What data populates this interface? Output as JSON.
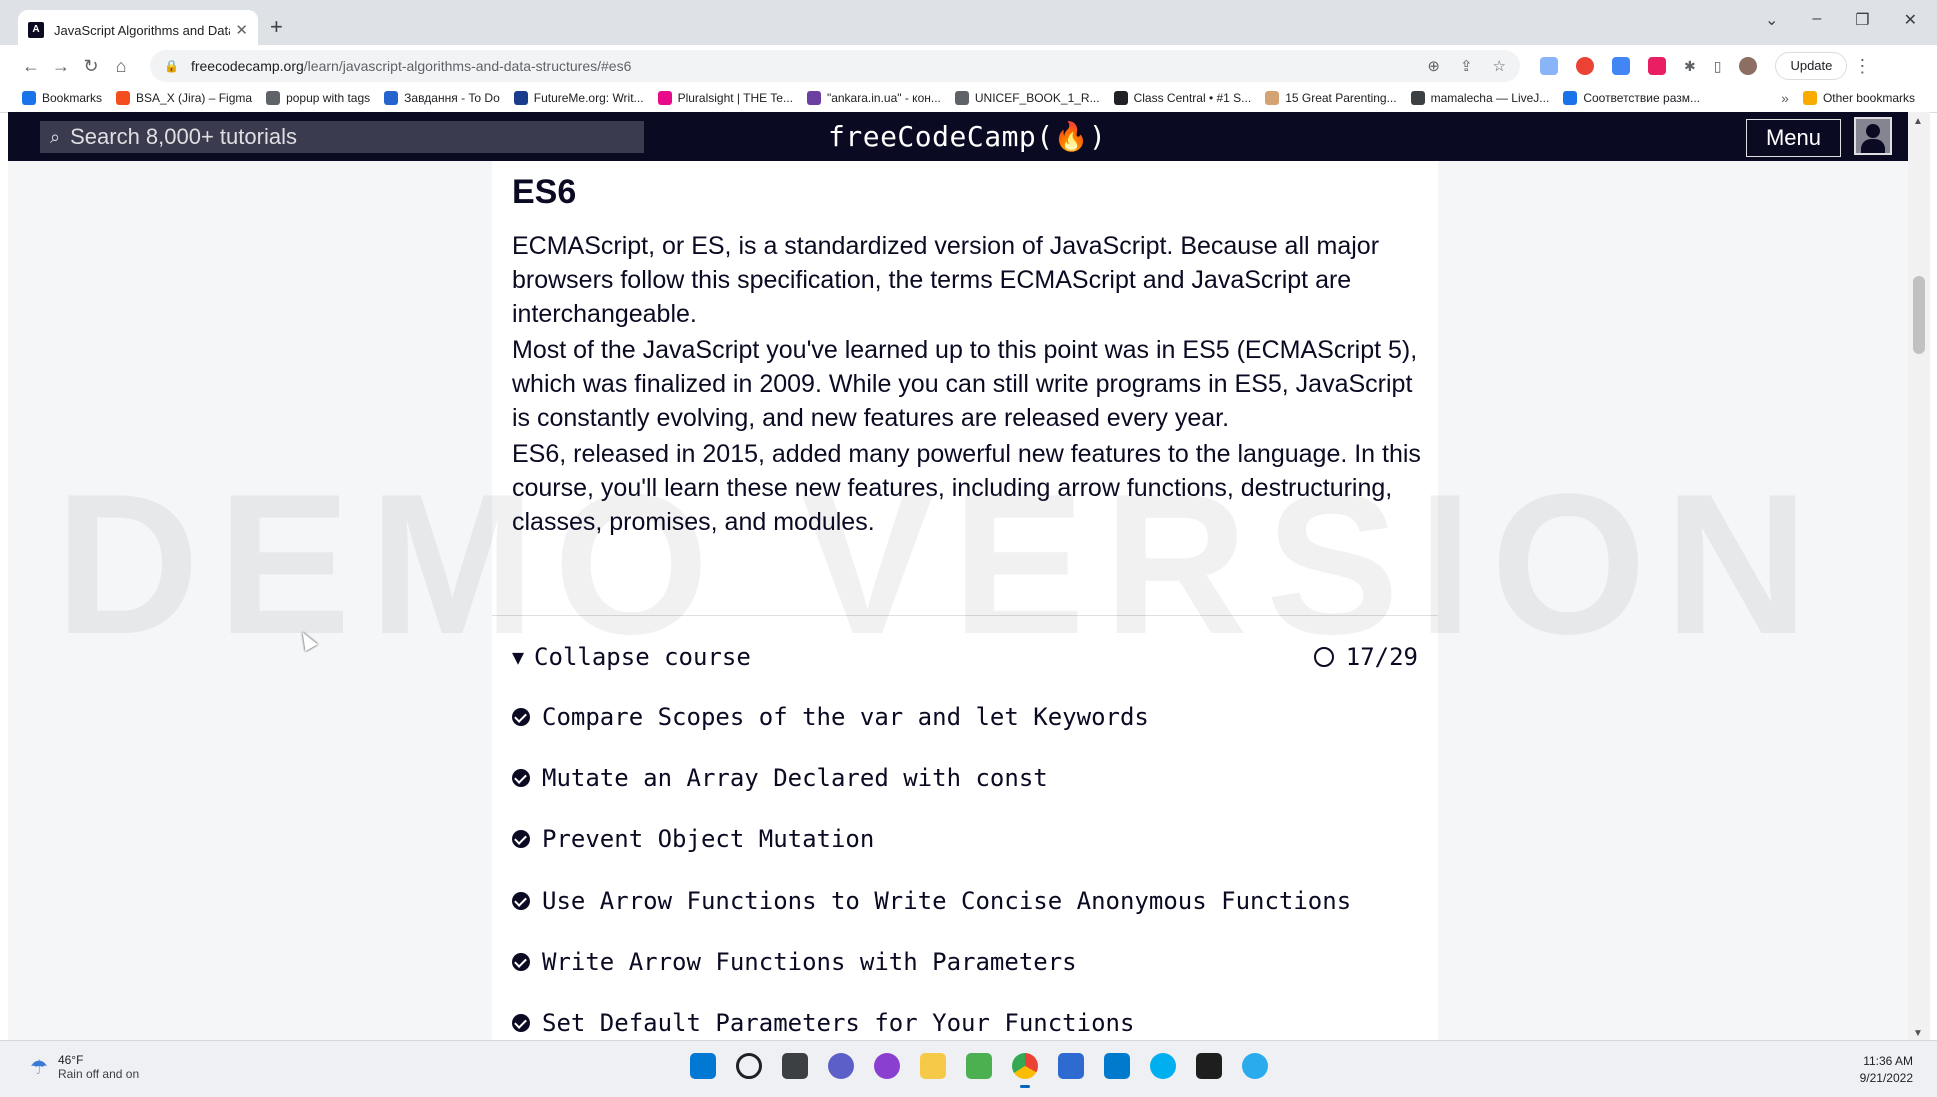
{
  "browser": {
    "tab_title": "JavaScript Algorithms and Data S",
    "url_host": "freecodecamp.org",
    "url_path": "/learn/javascript-algorithms-and-data-structures/#es6",
    "update_label": "Update",
    "bookmarks": [
      {
        "label": "Bookmarks",
        "color": "#1a73e8"
      },
      {
        "label": "BSA_X (Jira) – Figma",
        "color": "#f24e1e"
      },
      {
        "label": "popup with tags",
        "color": "#5f6368"
      },
      {
        "label": "Завдання - To Do",
        "color": "#2564cf"
      },
      {
        "label": "FutureMe.org: Writ...",
        "color": "#1a3c8c"
      },
      {
        "label": "Pluralsight | THE Te...",
        "color": "#e80a89"
      },
      {
        "label": "\"ankara.in.ua\" - кон...",
        "color": "#6b3fa0"
      },
      {
        "label": "UNICEF_BOOK_1_R...",
        "color": "#5f6368"
      },
      {
        "label": "Class Central • #1 S...",
        "color": "#202124"
      },
      {
        "label": "15 Great Parenting...",
        "color": "#d4a373"
      },
      {
        "label": "mamalecha — LiveJ...",
        "color": "#3c4043"
      },
      {
        "label": "Соответствие разм...",
        "color": "#1a73e8"
      }
    ],
    "other_bookmarks": "Other bookmarks"
  },
  "fcc": {
    "search_placeholder": "Search 8,000+ tutorials",
    "logo": "freeCodeCamp(🔥)",
    "menu_label": "Menu"
  },
  "block": {
    "title": "ES6",
    "paragraphs": [
      "ECMAScript, or ES, is a standardized version of JavaScript. Because all major browsers follow this specification, the terms ECMAScript and JavaScript are interchangeable.",
      "Most of the JavaScript you've learned up to this point was in ES5 (ECMAScript 5), which was finalized in 2009. While you can still write programs in ES5, JavaScript is constantly evolving, and new features are released every year.",
      "ES6, released in 2015, added many powerful new features to the language. In this course, you'll learn these new features, including arrow functions, destructuring, classes, promises, and modules."
    ],
    "collapse_label": "Collapse course",
    "progress": "17/29",
    "challenges": [
      "Compare Scopes of the var and let Keywords",
      "Mutate an Array Declared with const",
      "Prevent Object Mutation",
      "Use Arrow Functions to Write Concise Anonymous Functions",
      "Write Arrow Functions with Parameters",
      "Set Default Parameters for Your Functions"
    ]
  },
  "watermark": "DEMO VERSION",
  "taskbar": {
    "temperature": "46°F",
    "weather": "Rain off and on",
    "time": "11:36 AM",
    "date": "9/21/2022"
  }
}
